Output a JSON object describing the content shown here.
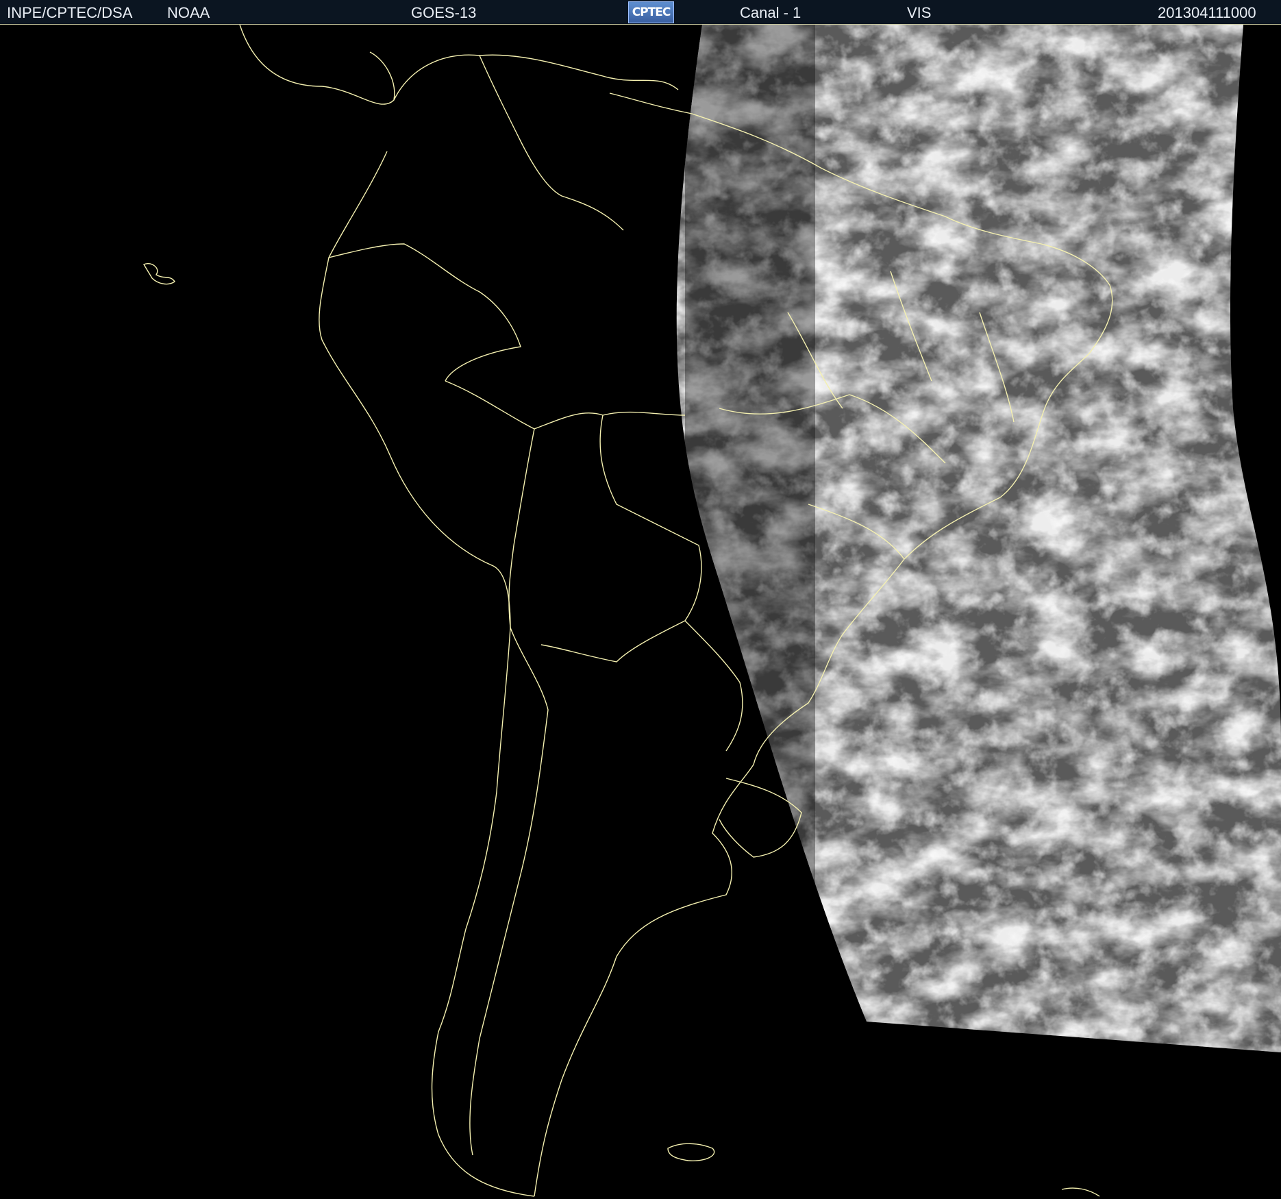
{
  "header": {
    "agency": "INPE/CPTEC/DSA",
    "source": "NOAA",
    "satellite": "GOES-13",
    "logo_text": "CPTEC",
    "channel": "Canal - 1",
    "band": "VIS",
    "timestamp": "201304111000"
  },
  "map": {
    "background_color": "#000000",
    "border_color": "#f4f0b0",
    "cloud_color": "#d8d8d8"
  }
}
